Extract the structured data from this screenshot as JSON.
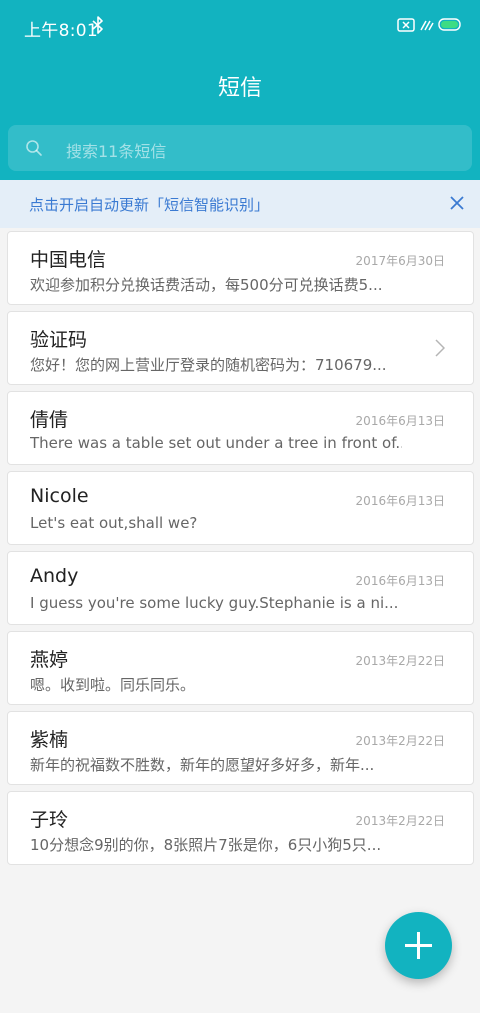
{
  "status_bar": {
    "time": "上午8:01"
  },
  "header": {
    "title": "短信"
  },
  "search": {
    "placeholder": "搜索11条短信"
  },
  "banner": {
    "text": "点击开启自动更新「短信智能识别」"
  },
  "conversations": [
    {
      "name": "中国电信",
      "date": "2017年6月30日",
      "preview": "欢迎参加积分兑换话费活动，每500分可兑换话费5..."
    },
    {
      "name": "验证码",
      "date": "",
      "preview": "您好！您的网上营业厅登录的随机密码为：710679..."
    },
    {
      "name": "倩倩",
      "date": "2016年6月13日",
      "preview": "There was a table set out under a tree in front of..."
    },
    {
      "name": "Nicole",
      "date": "2016年6月13日",
      "preview": "Let's eat out,shall we?"
    },
    {
      "name": "Andy",
      "date": "2016年6月13日",
      "preview": "I guess you're some lucky guy.Stephanie is a ni..."
    },
    {
      "name": "燕婷",
      "date": "2013年2月22日",
      "preview": "嗯。收到啦。同乐同乐。"
    },
    {
      "name": "紫楠",
      "date": "2013年2月22日",
      "preview": "新年的祝福数不胜数，新年的愿望好多好多，新年..."
    },
    {
      "name": "子玲",
      "date": "2013年2月22日",
      "preview": "10分想念9别的你，8张照片7张是你，6只小狗5只..."
    }
  ],
  "colors": {
    "accent": "#12b3c0",
    "banner_bg": "#e4eef8",
    "banner_text": "#3a7ad2"
  },
  "icons": {
    "status": [
      "bluetooth-icon",
      "sim-card-icon",
      "signal-icon",
      "battery-icon"
    ],
    "search": "search-icon",
    "banner_close": "close-icon",
    "card_chevron": "chevron-right-icon",
    "fab": "plus-icon"
  }
}
